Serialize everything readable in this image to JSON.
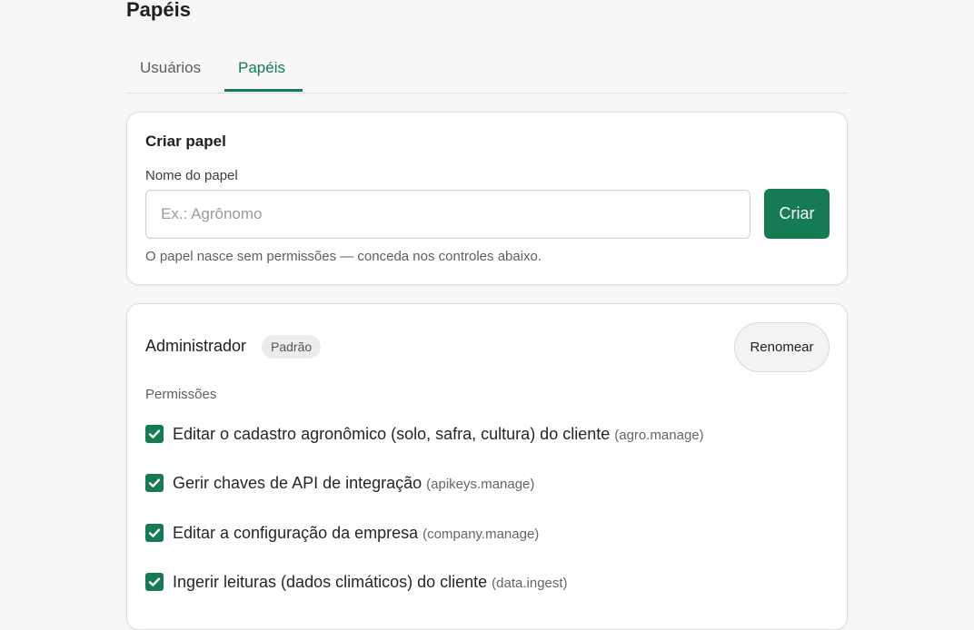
{
  "page": {
    "title": "Papéis"
  },
  "tabs": [
    {
      "label": "Usuários",
      "active": false
    },
    {
      "label": "Papéis",
      "active": true
    }
  ],
  "create_role": {
    "title": "Criar papel",
    "field_label": "Nome do papel",
    "input_value": "",
    "placeholder": "Ex.: Agrônomo",
    "button_label": "Criar",
    "hint": "O papel nasce sem permissões — conceda nos controles abaixo."
  },
  "role": {
    "name": "Administrador",
    "badge": "Padrão",
    "rename_label": "Renomear",
    "permissions_heading": "Permissões",
    "permissions": [
      {
        "label": "Editar o cadastro agronômico (solo, safra, cultura) do cliente",
        "code": "(agro.manage)",
        "checked": true
      },
      {
        "label": "Gerir chaves de API de integração",
        "code": "(apikeys.manage)",
        "checked": true
      },
      {
        "label": "Editar a configuração da empresa",
        "code": "(company.manage)",
        "checked": true
      },
      {
        "label": "Ingerir leituras (dados climáticos) do cliente",
        "code": "(data.ingest)",
        "checked": true
      }
    ]
  },
  "colors": {
    "accent": "#157b52",
    "background": "#f7f7f7",
    "card": "#ffffff"
  },
  "icons": {
    "checkbox": "checkmark-icon"
  }
}
